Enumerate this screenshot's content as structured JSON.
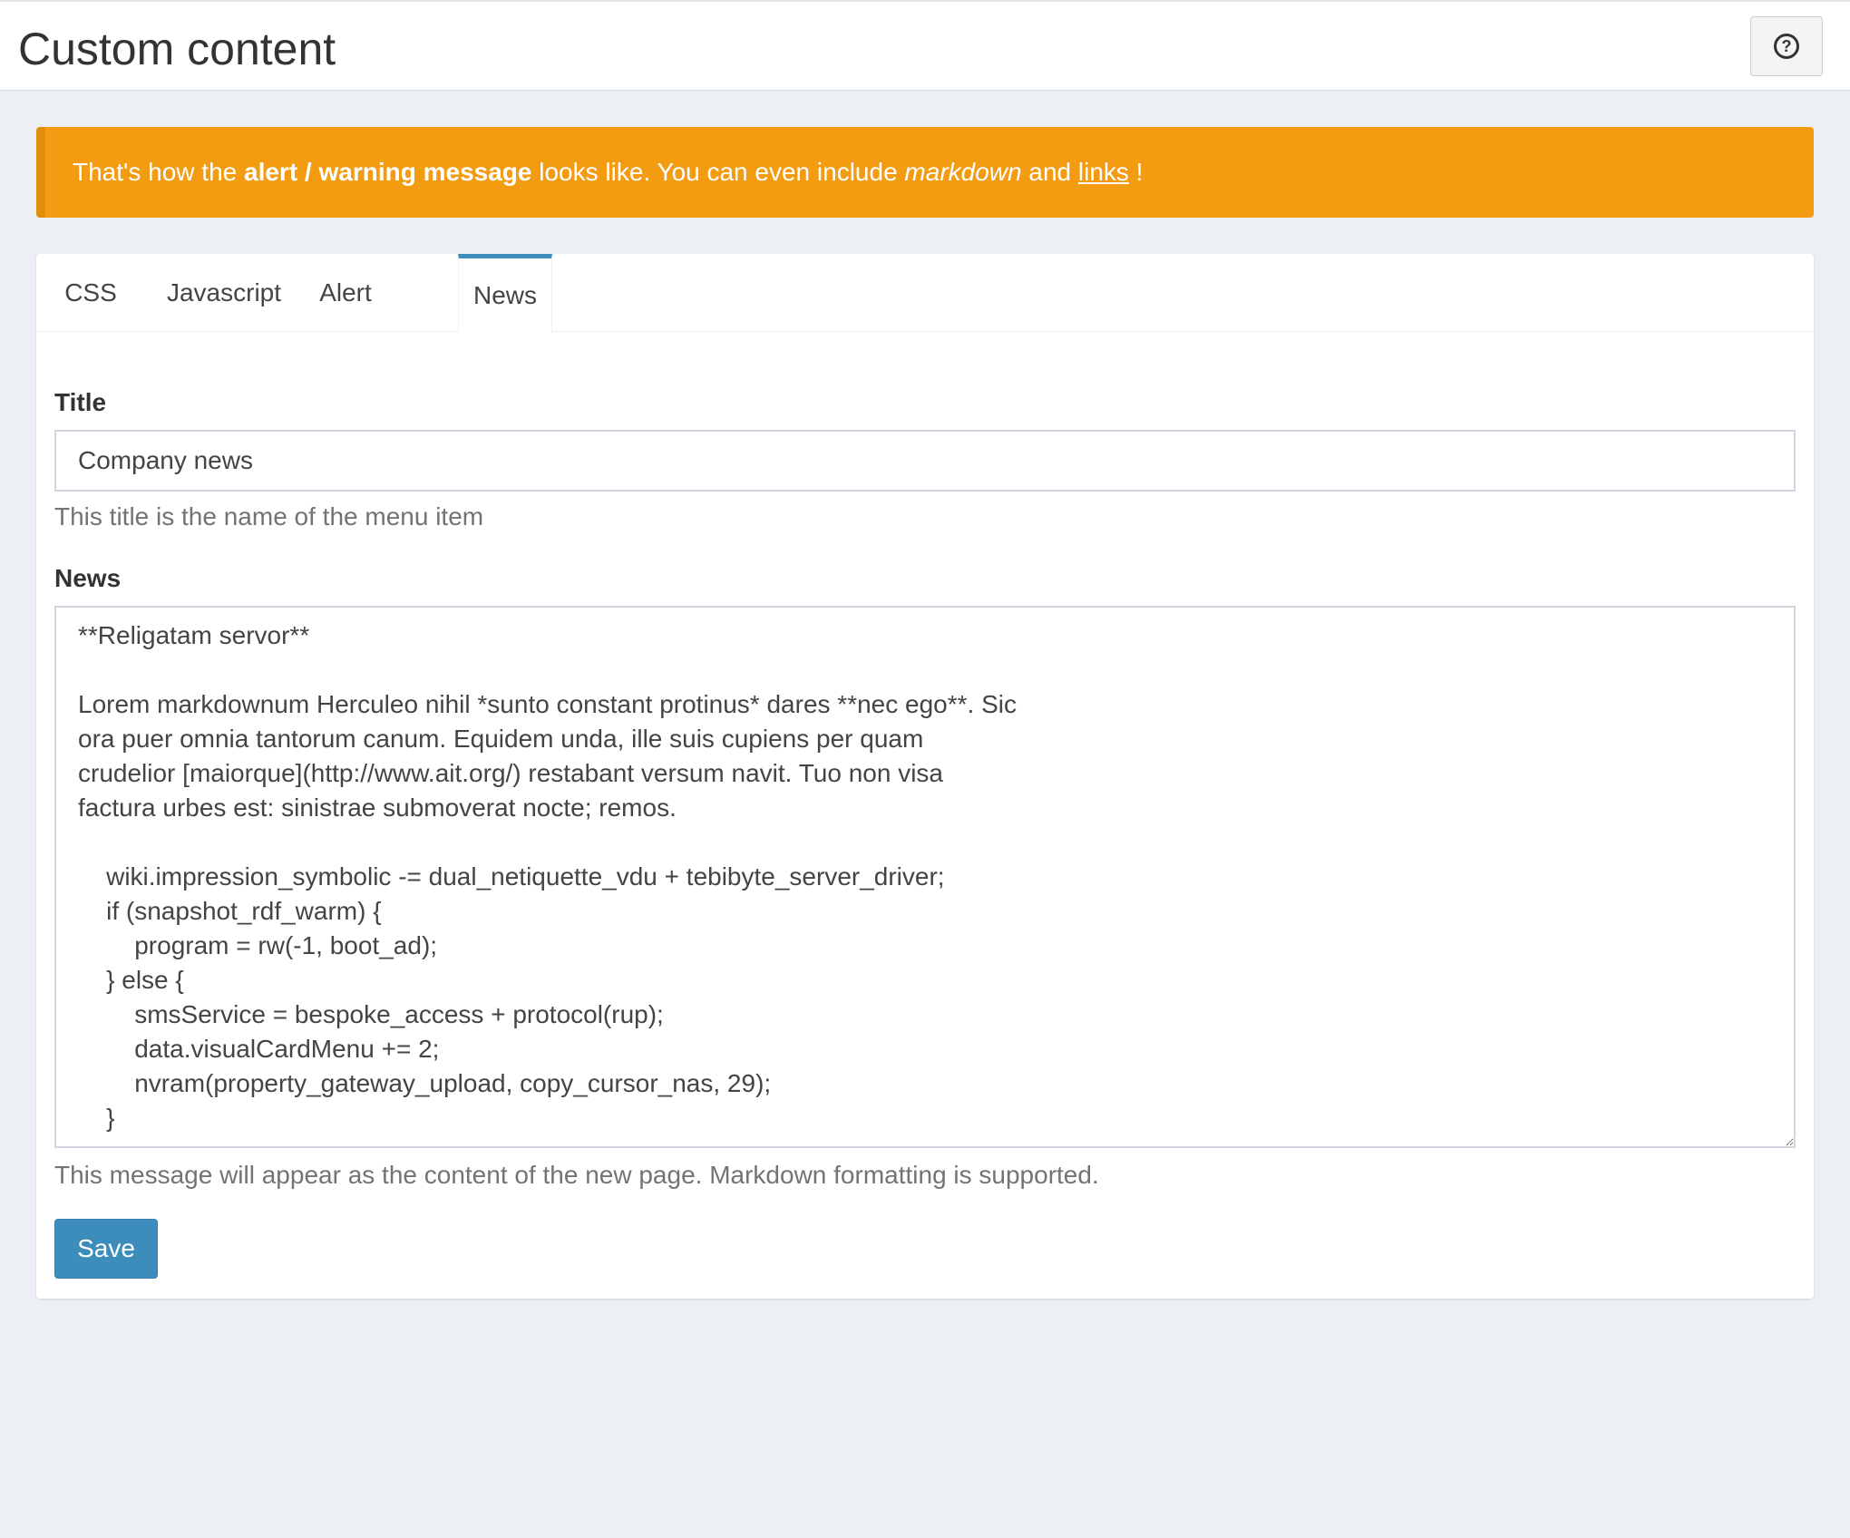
{
  "header": {
    "title": "Custom content",
    "help_icon": "question-circle-icon",
    "help_icon_glyph": "?"
  },
  "alert": {
    "prefix": "That's how the ",
    "bold": "alert / warning message",
    "middle": " looks like. You can even include ",
    "italic": "markdown",
    "and": " and ",
    "link": "links",
    "suffix": " !",
    "color": "#f39c12"
  },
  "tabs": [
    {
      "label": "CSS"
    },
    {
      "label": "Javascript"
    },
    {
      "label": "Alert"
    },
    {
      "label": "News",
      "active": true
    }
  ],
  "form": {
    "title_label": "Title",
    "title_value": "Company news",
    "title_help": "This title is the name of the menu item",
    "news_label": "News",
    "news_value": "**Religatam servor**\n\nLorem markdownum Herculeo nihil *sunto constant protinus* dares **nec ego**. Sic\nora puer omnia tantorum canum. Equidem unda, ille suis cupiens per quam\ncrudelior [maiorque](http://www.ait.org/) restabant versum navit. Tuo non visa\nfactura urbes est: sinistrae submoverat nocte; remos.\n\n    wiki.impression_symbolic -= dual_netiquette_vdu + tebibyte_server_driver;\n    if (snapshot_rdf_warm) {\n        program = rw(-1, boot_ad);\n    } else {\n        smsService = bespoke_access + protocol(rup);\n        data.visualCardMenu += 2;\n        nvram(property_gateway_upload, copy_cursor_nas, 29);\n    }",
    "news_help": "This message will appear as the content of the new page. Markdown formatting is supported.",
    "save_label": "Save",
    "accent_color": "#3c8dbc"
  }
}
